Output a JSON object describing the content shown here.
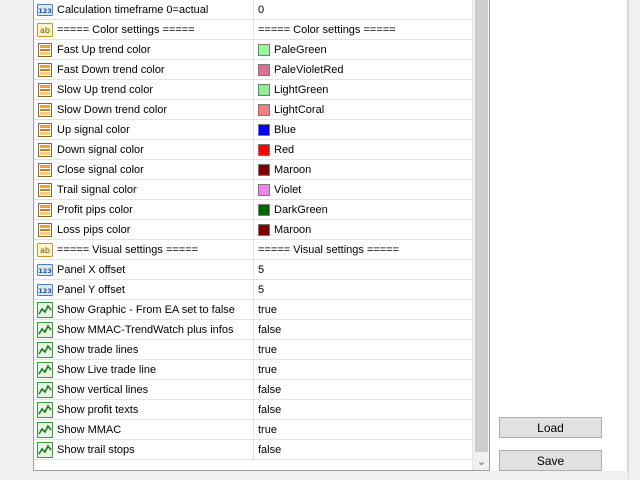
{
  "rows": [
    {
      "icon": "int",
      "name": "Calculation timeframe 0=actual",
      "value": "0"
    },
    {
      "icon": "str",
      "name": "===== Color settings =====",
      "value": "===== Color settings ====="
    },
    {
      "icon": "color",
      "name": "Fast Up trend color",
      "value": "PaleGreen",
      "swatch": "#98fb98"
    },
    {
      "icon": "color",
      "name": "Fast Down trend color",
      "value": "PaleVioletRed",
      "swatch": "#db7093"
    },
    {
      "icon": "color",
      "name": "Slow Up trend color",
      "value": "LightGreen",
      "swatch": "#90ee90"
    },
    {
      "icon": "color",
      "name": "Slow Down trend color",
      "value": "LightCoral",
      "swatch": "#f08080"
    },
    {
      "icon": "color",
      "name": "Up signal color",
      "value": "Blue",
      "swatch": "#0000ff"
    },
    {
      "icon": "color",
      "name": "Down signal color",
      "value": "Red",
      "swatch": "#ff0000"
    },
    {
      "icon": "color",
      "name": "Close signal color",
      "value": "Maroon",
      "swatch": "#800000"
    },
    {
      "icon": "color",
      "name": "Trail signal color",
      "value": "Violet",
      "swatch": "#ee82ee"
    },
    {
      "icon": "color",
      "name": "Profit pips color",
      "value": "DarkGreen",
      "swatch": "#006400"
    },
    {
      "icon": "color",
      "name": "Loss pips color",
      "value": "Maroon",
      "swatch": "#800000"
    },
    {
      "icon": "str",
      "name": "===== Visual settings =====",
      "value": "===== Visual settings ====="
    },
    {
      "icon": "int",
      "name": "Panel X offset",
      "value": "5"
    },
    {
      "icon": "int",
      "name": "Panel Y offset",
      "value": "5"
    },
    {
      "icon": "bool",
      "name": "Show Graphic - From EA set to false",
      "value": "true"
    },
    {
      "icon": "bool",
      "name": "Show MMAC-TrendWatch plus infos",
      "value": "false"
    },
    {
      "icon": "bool",
      "name": "Show trade lines",
      "value": "true"
    },
    {
      "icon": "bool",
      "name": "Show Live trade line",
      "value": "true"
    },
    {
      "icon": "bool",
      "name": "Show vertical lines",
      "value": "false"
    },
    {
      "icon": "bool",
      "name": "Show profit texts",
      "value": "false"
    },
    {
      "icon": "bool",
      "name": "Show MMAC",
      "value": "true"
    },
    {
      "icon": "bool",
      "name": "Show trail stops",
      "value": "false"
    }
  ],
  "buttons": {
    "load": "Load",
    "save": "Save"
  },
  "icon_names": {
    "int": "integer-123-icon",
    "str": "string-ab-icon",
    "color": "color-palette-icon",
    "bool": "boolean-chart-icon"
  },
  "scroll_arrow": "⌄"
}
